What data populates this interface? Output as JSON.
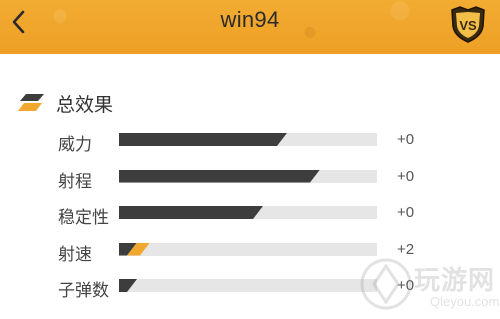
{
  "header": {
    "title": "win94",
    "vs_label": "VS",
    "back_icon": "chevron-left-icon",
    "vs_icon": "vs-shield-icon",
    "color": "#f0a82e"
  },
  "section": {
    "title": "总效果",
    "icon": "layers-icon"
  },
  "stats": [
    {
      "label": "威力",
      "level": 0.65,
      "bonus": 0,
      "delta": "+0"
    },
    {
      "label": "射程",
      "level": 0.78,
      "bonus": 0,
      "delta": "+0"
    },
    {
      "label": "稳定性",
      "level": 0.56,
      "bonus": 0,
      "delta": "+0"
    },
    {
      "label": "射速",
      "level": 0.07,
      "bonus": 0.05,
      "delta": "+2"
    },
    {
      "label": "子弹数",
      "level": 0.07,
      "bonus": 0,
      "delta": "+0"
    }
  ],
  "colors": {
    "fill": "#3d3d3d",
    "bonus": "#f0a82e",
    "track": "#e6e6e6"
  },
  "watermark": {
    "text": "玩游网",
    "sub": "Qleyou.com"
  }
}
